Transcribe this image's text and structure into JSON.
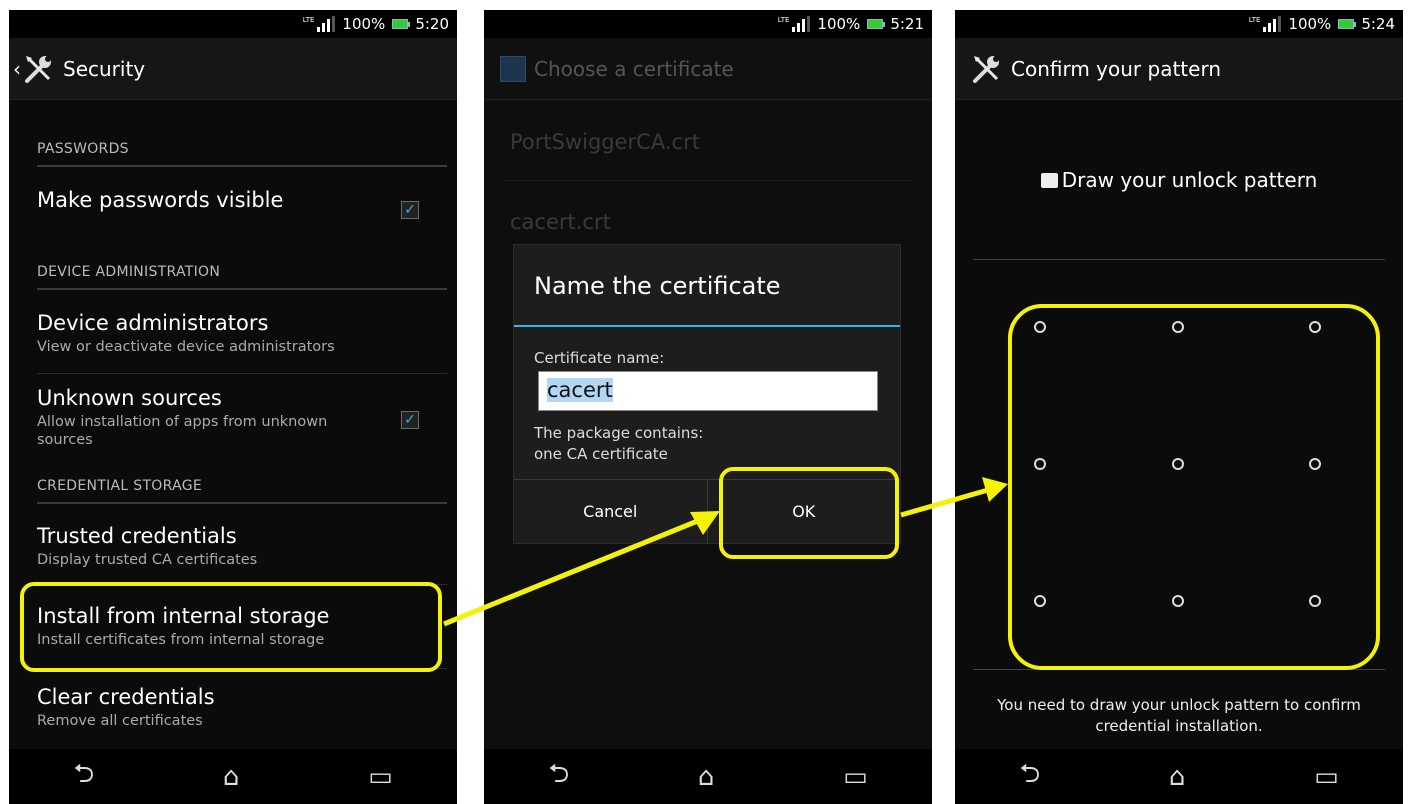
{
  "screen1": {
    "status": {
      "network": "LTE",
      "battery": "100%",
      "time": "5:20"
    },
    "title": "Security",
    "sections": {
      "passwords": "PASSWORDS",
      "device_admin": "DEVICE ADMINISTRATION",
      "credential_storage": "CREDENTIAL STORAGE"
    },
    "items": {
      "make_passwords_visible": {
        "title": "Make passwords visible",
        "checked": true
      },
      "device_administrators": {
        "title": "Device administrators",
        "subtitle": "View or deactivate device administrators"
      },
      "unknown_sources": {
        "title": "Unknown sources",
        "subtitle": "Allow installation of apps from unknown sources",
        "checked": true
      },
      "trusted_credentials": {
        "title": "Trusted credentials",
        "subtitle": "Display trusted CA certificates"
      },
      "install_internal": {
        "title": "Install from internal storage",
        "subtitle": "Install certificates from internal storage"
      },
      "clear_credentials": {
        "title": "Clear credentials",
        "subtitle": "Remove all certificates"
      }
    }
  },
  "screen2": {
    "status": {
      "network": "LTE",
      "battery": "100%",
      "time": "5:21"
    },
    "title": "Choose a certificate",
    "files": [
      "PortSwiggerCA.crt",
      "cacert.crt"
    ],
    "dialog": {
      "title": "Name the certificate",
      "label": "Certificate name:",
      "value": "cacert",
      "message_line1": "The package contains:",
      "message_line2": "one CA certificate",
      "cancel": "Cancel",
      "ok": "OK"
    }
  },
  "screen3": {
    "status": {
      "network": "LTE",
      "battery": "100%",
      "time": "5:24"
    },
    "title": "Confirm your pattern",
    "prompt": "Draw your unlock pattern",
    "footer": "You need to draw your unlock pattern to confirm credential installation."
  },
  "nav_icons": [
    "back-icon",
    "home-icon",
    "recent-apps-icon"
  ],
  "colors": {
    "accent": "#33b5e5",
    "highlight": "#f5f20a",
    "background": "#0b0b0b"
  }
}
